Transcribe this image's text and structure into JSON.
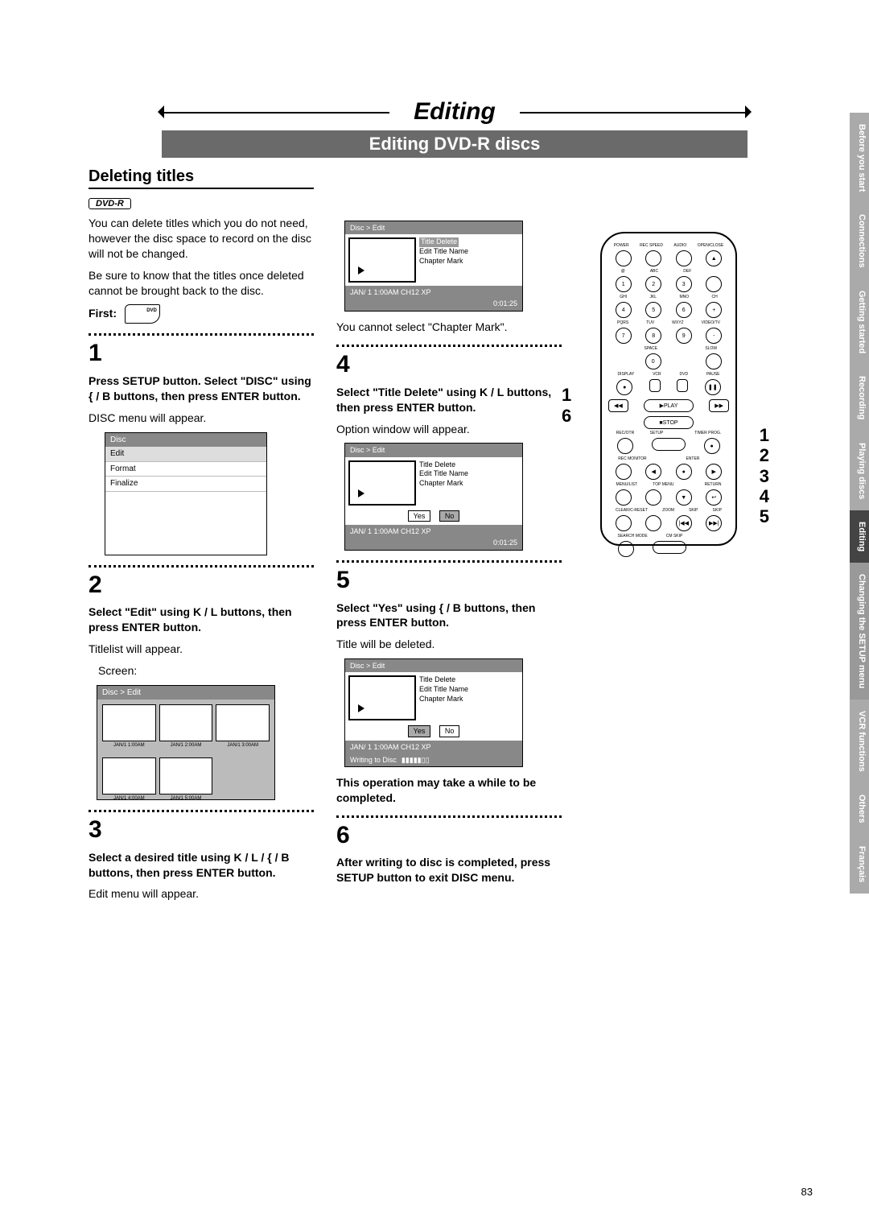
{
  "title": "Editing",
  "subtitle": "Editing DVD-R discs",
  "section": "Deleting titles",
  "disc_badge": "DVD-R",
  "intro_p1": "You can delete titles which you do not need, however the disc space to record on the disc will not be changed.",
  "intro_p2": "Be sure to know that the titles once deleted cannot be brought back to the disc.",
  "first_label": "First:",
  "steps": {
    "s1": {
      "num": "1",
      "bold": "Press SETUP button. Select \"DISC\" using { / B buttons, then press ENTER button.",
      "text": "DISC menu will appear."
    },
    "s2": {
      "num": "2",
      "bold": "Select \"Edit\" using K / L buttons, then press ENTER button.",
      "text": "Titlelist will appear.",
      "text2": "Screen:"
    },
    "s3": {
      "num": "3",
      "bold": "Select a desired title using K / L / { / B buttons, then press ENTER button.",
      "text": "Edit menu will appear."
    },
    "s4": {
      "num": "4",
      "bold": "Select \"Title Delete\" using K / L buttons, then press ENTER button.",
      "text": "Option window will appear.",
      "pre": "You cannot select \"Chapter Mark\"."
    },
    "s5": {
      "num": "5",
      "bold": "Select \"Yes\" using { / B buttons, then press ENTER button.",
      "text": "Title will be deleted.",
      "warn": "This operation may take a while to be completed."
    },
    "s6": {
      "num": "6",
      "bold": "After writing to disc is completed, press SETUP button to exit DISC menu."
    }
  },
  "disc_menu": {
    "title": "Disc",
    "items": [
      "Edit",
      "Format",
      "Finalize"
    ]
  },
  "titlelist": {
    "title": "Disc > Edit",
    "cells": [
      "JAN/1  1:00AM",
      "JAN/1  2:00AM",
      "JAN/1  3:00AM",
      "JAN/1  4:00AM",
      "JAN/1  5:00AM"
    ]
  },
  "edit_menu": {
    "title": "Disc > Edit",
    "options": [
      "Title Delete",
      "Edit Title Name",
      "Chapter Mark"
    ],
    "status": "JAN/ 1   1:00AM  CH12    XP",
    "dur": "0:01:25",
    "yes": "Yes",
    "no": "No",
    "writing": "Writing to Disc"
  },
  "remote": {
    "row1": [
      "POWER",
      "REC SPEED",
      "AUDIO",
      "OPEN/CLOSE"
    ],
    "row2_lbl": [
      "@",
      "ABC",
      "DEF"
    ],
    "row2": [
      "1",
      "2",
      "3"
    ],
    "row3_lbl": [
      "GHI",
      "JKL",
      "MNO",
      "CH"
    ],
    "row3": [
      "4",
      "5",
      "6",
      "+"
    ],
    "row4_lbl": [
      "PQRS",
      "TUV",
      "WXYZ",
      "VIDEO/TV"
    ],
    "row4": [
      "7",
      "8",
      "9",
      "-"
    ],
    "row5_lbl": [
      "",
      "SPACE",
      "",
      "SLOW"
    ],
    "row5": [
      "",
      "0",
      "",
      ""
    ],
    "row6_lbl": [
      "DISPLAY",
      "VCR",
      "DVD",
      "PAUSE"
    ],
    "row6": [
      "●",
      "",
      "",
      "❚❚"
    ],
    "play": "PLAY",
    "stop": "STOP",
    "row7_lbl": [
      "REC/OTR",
      "SETUP",
      "",
      "TIMER PROG."
    ],
    "row8_lbl": [
      "REC MONITOR",
      "",
      "ENTER",
      ""
    ],
    "row9_lbl": [
      "MENU/LIST",
      "TOP MENU",
      "",
      "RETURN"
    ],
    "row10_lbl": [
      "CLEAR/C-RESET",
      "ZOOM",
      "SKIP",
      "SKIP"
    ],
    "row11_lbl": [
      "SEARCH MODE",
      "CM SKIP",
      "",
      ""
    ]
  },
  "callouts": {
    "left": [
      "1",
      "6"
    ],
    "right": [
      "1",
      "2",
      "3",
      "4",
      "5"
    ]
  },
  "tabs": [
    "Before you start",
    "Connections",
    "Getting started",
    "Recording",
    "Playing discs",
    "Editing",
    "Changing the SETUP menu",
    "VCR functions",
    "Others",
    "Français"
  ],
  "page_num": "83"
}
